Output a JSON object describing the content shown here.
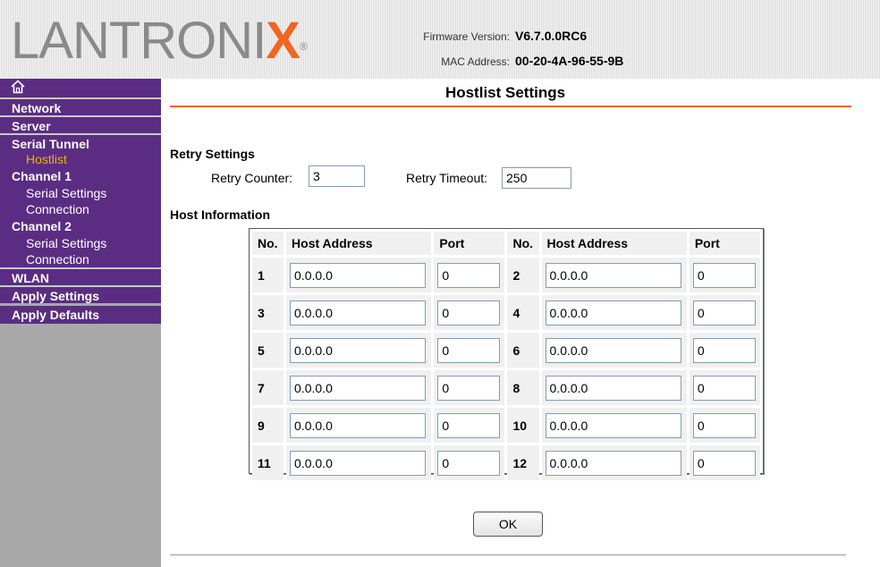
{
  "header": {
    "logo_text_main": "LANTRONI",
    "logo_text_x": "X",
    "logo_reg": "®",
    "firmware_label": "Firmware Version:",
    "firmware_value": "V6.7.0.0RC6",
    "mac_label": "MAC Address:",
    "mac_value": "00-20-4A-96-55-9B"
  },
  "sidebar": {
    "home_icon": "⌂",
    "items": {
      "network": "Network",
      "server": "Server",
      "serial_tunnel": "Serial Tunnel",
      "hostlist": "Hostlist",
      "channel1": "Channel 1",
      "ch1_serial": "Serial Settings",
      "ch1_connection": "Connection",
      "channel2": "Channel 2",
      "ch2_serial": "Serial Settings",
      "ch2_connection": "Connection",
      "wlan": "WLAN",
      "apply_settings": "Apply Settings",
      "apply_defaults": "Apply Defaults"
    }
  },
  "main": {
    "title": "Hostlist Settings",
    "retry_section": "Retry Settings",
    "retry_counter_label": "Retry Counter:",
    "retry_counter_value": "3",
    "retry_timeout_label": "Retry Timeout:",
    "retry_timeout_value": "250",
    "host_section": "Host Information",
    "columns": {
      "no": "No.",
      "host": "Host Address",
      "port": "Port"
    },
    "hosts": [
      {
        "no": "1",
        "addr": "0.0.0.0",
        "port": "0"
      },
      {
        "no": "2",
        "addr": "0.0.0.0",
        "port": "0"
      },
      {
        "no": "3",
        "addr": "0.0.0.0",
        "port": "0"
      },
      {
        "no": "4",
        "addr": "0.0.0.0",
        "port": "0"
      },
      {
        "no": "5",
        "addr": "0.0.0.0",
        "port": "0"
      },
      {
        "no": "6",
        "addr": "0.0.0.0",
        "port": "0"
      },
      {
        "no": "7",
        "addr": "0.0.0.0",
        "port": "0"
      },
      {
        "no": "8",
        "addr": "0.0.0.0",
        "port": "0"
      },
      {
        "no": "9",
        "addr": "0.0.0.0",
        "port": "0"
      },
      {
        "no": "10",
        "addr": "0.0.0.0",
        "port": "0"
      },
      {
        "no": "11",
        "addr": "0.0.0.0",
        "port": "0"
      },
      {
        "no": "12",
        "addr": "0.0.0.0",
        "port": "0"
      }
    ],
    "ok_label": "OK"
  },
  "colors": {
    "nav_purple": "#5a2d82",
    "accent_orange": "#f26522",
    "active_item": "#f0b000",
    "sidebar_gray": "#a9a9a9"
  }
}
